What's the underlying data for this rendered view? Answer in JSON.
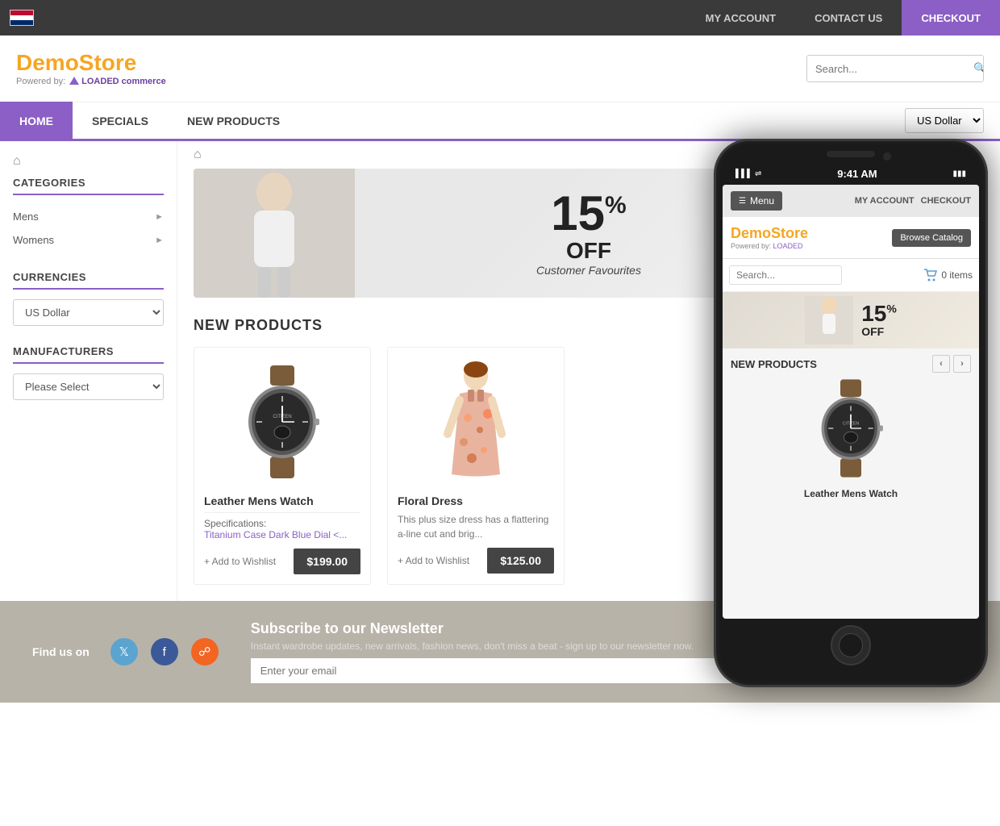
{
  "topbar": {
    "my_account": "MY ACCOUNT",
    "contact_us": "CONTACT US",
    "checkout": "CHECKOUT"
  },
  "header": {
    "logo_demo": "Demo",
    "logo_store": "Store",
    "logo_powered": "Powered by:",
    "logo_loaded": "LOADED commerce",
    "search_placeholder": "Search..."
  },
  "nav": {
    "home": "HOME",
    "specials": "SPECIALS",
    "new_products": "NEW PRODUCTS",
    "currency": "US Dollar"
  },
  "sidebar": {
    "categories_title": "CATEGORIES",
    "category_mens": "Mens",
    "category_womens": "Womens",
    "currencies_title": "CURRENCIES",
    "currency_default": "US Dollar",
    "manufacturers_title": "MANUFACTURERS",
    "manufacturers_default": "Please Select"
  },
  "banner": {
    "percent": "15",
    "off": "OFF",
    "subtitle": "Customer Favourites"
  },
  "new_products": {
    "title": "NEW PRODUCTS",
    "products": [
      {
        "id": "watch",
        "name": "Leather Mens Watch",
        "description": "Specifications:",
        "spec_link": "Titanium Case Dark Blue Dial <...",
        "price": "$199.00",
        "wishlist": "+ Add to Wishlist"
      },
      {
        "id": "dress",
        "name": "Floral Dress",
        "description": "This plus size dress has a flattering a-line cut and brig...",
        "price": "$125.00",
        "wishlist": "+ Add to Wishlist"
      }
    ]
  },
  "footer": {
    "find_us": "Find us on",
    "newsletter_title": "Subscribe to our Newsletter",
    "newsletter_desc": "Instant wardrobe updates, new arrivals, fashion news, don't miss a beat - sign up to our newsletter now.",
    "newsletter_placeholder": "Enter your email"
  },
  "phone": {
    "time": "9:41 AM",
    "signal": "▌▌▌",
    "menu": "Menu",
    "my_account": "MY ACCOUNT",
    "checkout": "CHECKOUT",
    "logo_demo": "Demo",
    "logo_store": "Store",
    "browse_catalog": "Browse Catalog",
    "search_placeholder": "Search...",
    "cart_items": "0 items",
    "banner_percent": "15",
    "banner_off": "OFF",
    "new_products_title": "NEW PRODUCTS",
    "product_name": "Leather Mens Watch"
  }
}
